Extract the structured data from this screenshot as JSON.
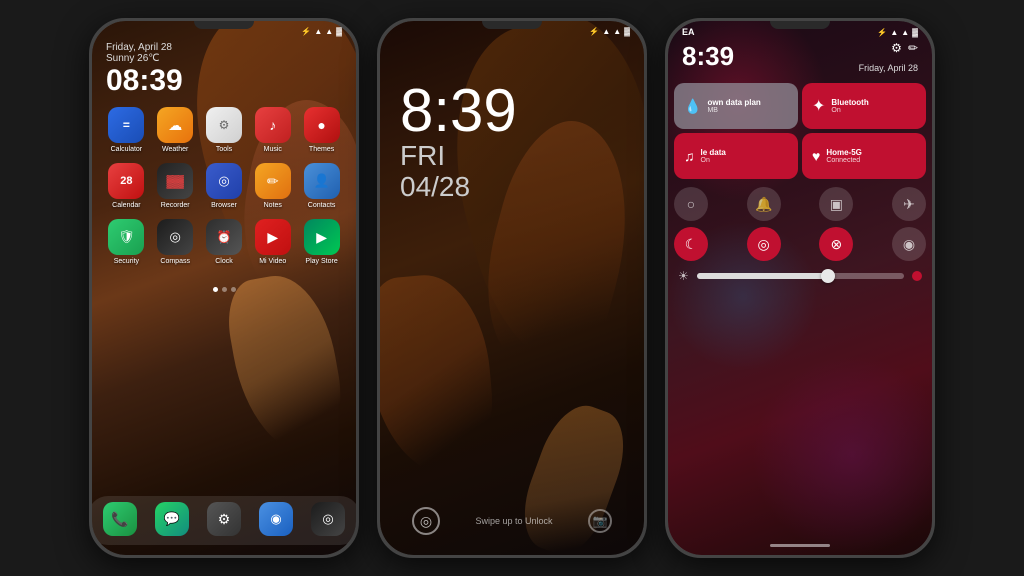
{
  "phone1": {
    "statusBar": {
      "bluetooth": "🔵",
      "signal": "▲▲▲",
      "wifi": "▲",
      "battery": "▓"
    },
    "date": "Friday, April 28",
    "weather": "Sunny 26℃",
    "time": "08:39",
    "apps": [
      [
        {
          "label": "Calculator",
          "icon": "=",
          "class": "ic-calc"
        },
        {
          "label": "Weather",
          "icon": "☁",
          "class": "ic-weather"
        },
        {
          "label": "Tools",
          "icon": "🔧",
          "class": "ic-tools"
        },
        {
          "label": "Music",
          "icon": "♪",
          "class": "ic-music"
        },
        {
          "label": "Themes",
          "icon": "●",
          "class": "ic-themes"
        }
      ],
      [
        {
          "label": "Calendar",
          "icon": "28",
          "class": "ic-calendar"
        },
        {
          "label": "Recorder",
          "icon": "🎙",
          "class": "ic-recorder"
        },
        {
          "label": "Browser",
          "icon": "🌐",
          "class": "ic-browser"
        },
        {
          "label": "Notes",
          "icon": "✏",
          "class": "ic-notes"
        },
        {
          "label": "Contacts",
          "icon": "👤",
          "class": "ic-contacts"
        }
      ],
      [
        {
          "label": "Security",
          "icon": "🛡",
          "class": "ic-security"
        },
        {
          "label": "Compass",
          "icon": "◎",
          "class": "ic-compass"
        },
        {
          "label": "Clock",
          "icon": "⏰",
          "class": "ic-clock"
        },
        {
          "label": "Mi Video",
          "icon": "▶",
          "class": "ic-mivideo"
        },
        {
          "label": "Play Store",
          "icon": "▶",
          "class": "ic-playstore"
        }
      ]
    ],
    "dock": [
      {
        "label": "Phone",
        "icon": "📞",
        "class": "ic-phone"
      },
      {
        "label": "WhatsApp",
        "icon": "💬",
        "class": "ic-whatsapp"
      },
      {
        "label": "Settings",
        "icon": "⚙",
        "class": "ic-settings"
      },
      {
        "label": "Themes",
        "icon": "◉",
        "class": "ic-themes2"
      },
      {
        "label": "Camera",
        "icon": "◎",
        "class": "ic-camera2"
      }
    ]
  },
  "phone2": {
    "time": "8:39",
    "day": "FRI",
    "date": "04/28",
    "swipeText": "Swipe up to Unlock"
  },
  "phone3": {
    "userInitials": "EA",
    "time": "8:39",
    "dateLabel": "Friday, April 28",
    "tiles": [
      {
        "title": "own data plan",
        "subtitle": "MB",
        "icon": "💧",
        "style": "tile-gray"
      },
      {
        "title": "Bluetooth",
        "subtitle": "On",
        "icon": "✦",
        "style": "tile-red"
      },
      {
        "title": "le data",
        "subtitle": "On",
        "icon": "♫",
        "style": "tile-red"
      },
      {
        "title": "Home-5G",
        "subtitle": "Connected",
        "icon": "♥",
        "style": "tile-red"
      }
    ],
    "toggles1": [
      {
        "icon": "○",
        "active": false
      },
      {
        "icon": "🔔",
        "active": false
      },
      {
        "icon": "▣",
        "active": false
      },
      {
        "icon": "✈",
        "active": false
      }
    ],
    "toggles2": [
      {
        "icon": "☾",
        "active": true
      },
      {
        "icon": "◎",
        "active": true
      },
      {
        "icon": "⊗",
        "active": true
      },
      {
        "icon": "◉",
        "active": false
      }
    ],
    "brightness": "65"
  }
}
